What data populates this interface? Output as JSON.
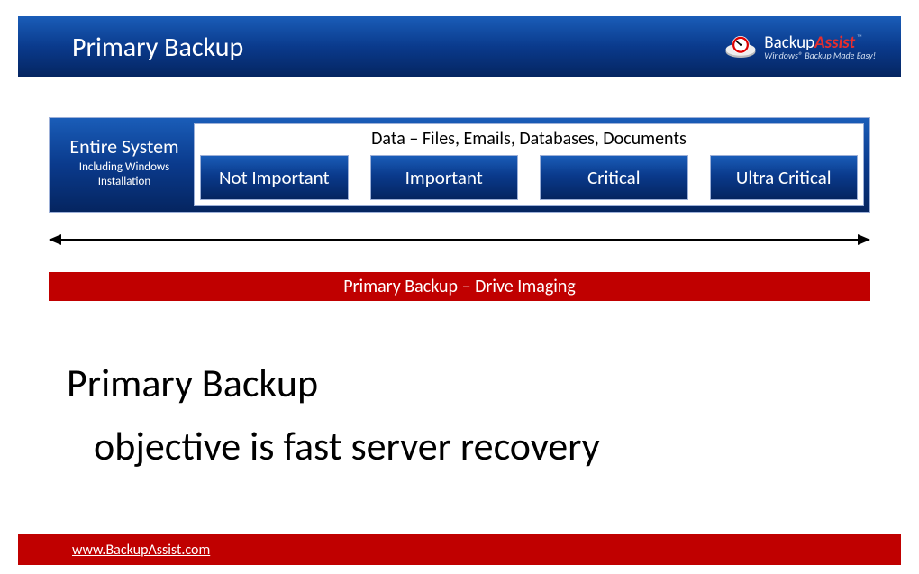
{
  "header": {
    "title": "Primary Backup",
    "brandName": "Backup",
    "brandSuffix": "Assist",
    "brandTag": "Windows® Backup Made Easy!"
  },
  "panel": {
    "leftTitle": "Entire System",
    "leftSub": "Including Windows Installation",
    "dataTitle": "Data – Files, Emails, Databases, Documents",
    "tiers": [
      "Not Important",
      "Important",
      "Critical",
      "Ultra Critical"
    ]
  },
  "redBar": "Primary Backup – Drive Imaging",
  "body": {
    "line1": "Primary Backup",
    "line2": "objective is fast server recovery"
  },
  "footer": {
    "url": "www.BackupAssist.com"
  }
}
